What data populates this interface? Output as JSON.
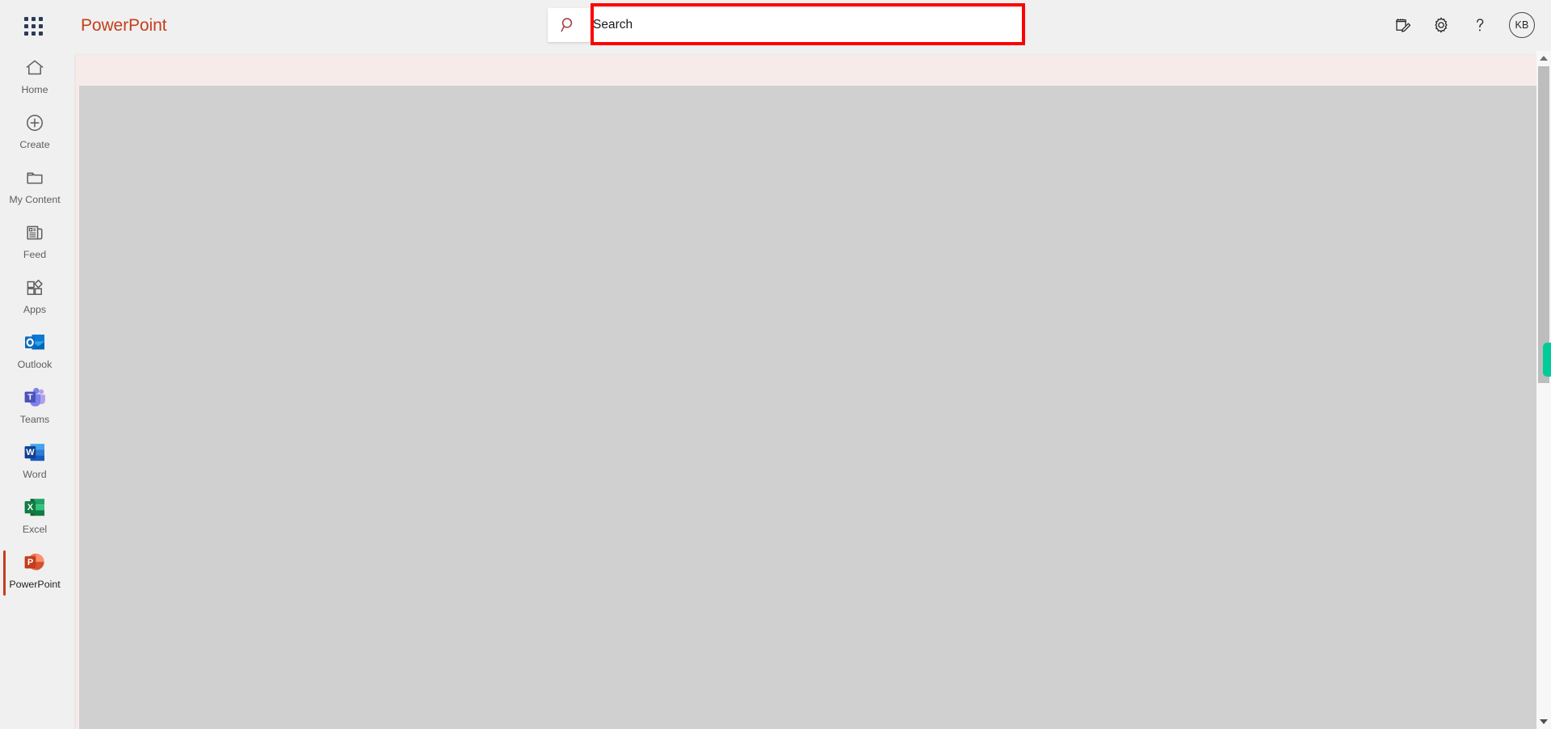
{
  "app": {
    "brand": "PowerPoint",
    "waffle_icon": "app-launcher-waffle-icon",
    "brand_color": "#c43e1c"
  },
  "search": {
    "placeholder": "Search",
    "value": "",
    "icon": "search-icon",
    "annotation_color": "#ff0000"
  },
  "top_right": {
    "items": [
      {
        "name": "notepad-pencil-icon",
        "label": "Notes"
      },
      {
        "name": "gear-icon",
        "label": "Settings"
      },
      {
        "name": "question-mark-icon",
        "label": "Help"
      }
    ],
    "avatar": {
      "initials": "KB",
      "name": "account-manager-avatar"
    }
  },
  "sidebar": {
    "items": [
      {
        "label": "Home",
        "icon": "home-icon",
        "selected": false
      },
      {
        "label": "Create",
        "icon": "plus-circle-icon",
        "selected": false
      },
      {
        "label": "My Content",
        "icon": "folder-icon",
        "selected": false
      },
      {
        "label": "Feed",
        "icon": "feed-icon",
        "selected": false
      },
      {
        "label": "Apps",
        "icon": "apps-grid-icon",
        "selected": false
      },
      {
        "label": "Outlook",
        "icon": "outlook-icon",
        "selected": false
      },
      {
        "label": "Teams",
        "icon": "teams-icon",
        "selected": false
      },
      {
        "label": "Word",
        "icon": "word-icon",
        "selected": false
      },
      {
        "label": "Excel",
        "icon": "excel-icon",
        "selected": false
      },
      {
        "label": "PowerPoint",
        "icon": "powerpoint-icon",
        "selected": true
      }
    ]
  },
  "main": {
    "banner_color": "#f7ebe9",
    "canvas_color": "#d0d0d0",
    "content_text": ""
  },
  "scrollbar": {
    "up_arrow": "scroll-up-arrow-icon",
    "down_arrow": "scroll-down-arrow-icon",
    "marker_color": "#00cc99"
  }
}
